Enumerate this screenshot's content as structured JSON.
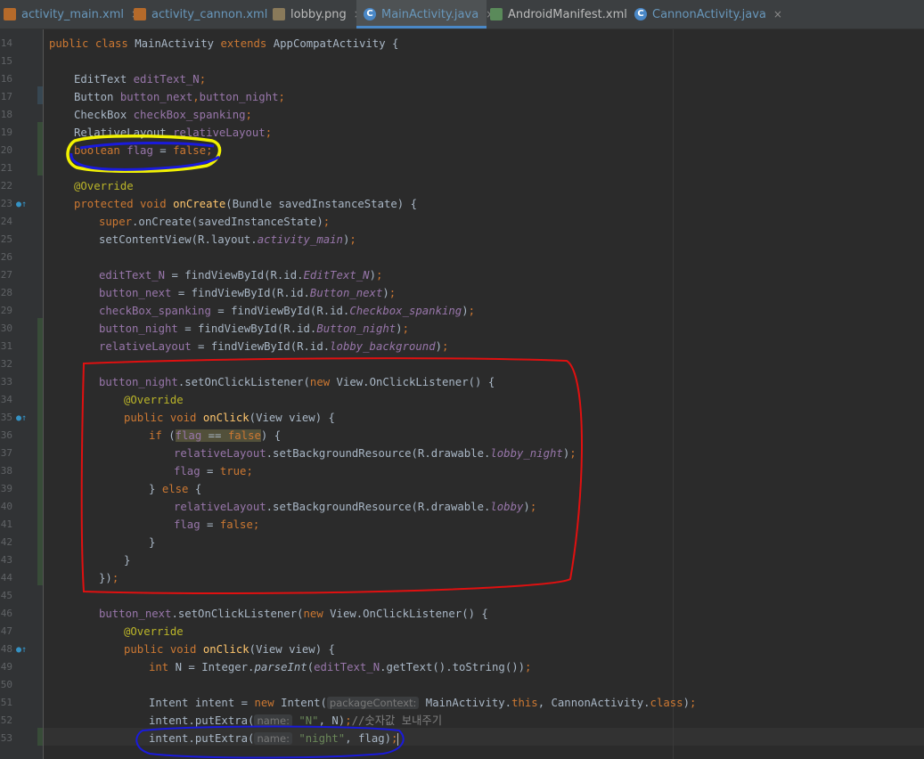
{
  "tabs": [
    {
      "name": "activity_main.xml",
      "icon": "xml-file-icon"
    },
    {
      "name": "activity_cannon.xml",
      "icon": "xml-file-icon"
    },
    {
      "name": "lobby.png",
      "icon": "image-file-icon"
    },
    {
      "name": "MainActivity.java",
      "icon": "java-class-icon",
      "active": true
    },
    {
      "name": "AndroidManifest.xml",
      "icon": "manifest-file-icon"
    },
    {
      "name": "CannonActivity.java",
      "icon": "java-class-icon"
    }
  ],
  "close_glyph": "×",
  "line_numbers": [
    "14",
    "15",
    "16",
    "17",
    "18",
    "19",
    "20",
    "21",
    "22",
    "23",
    "24",
    "25",
    "26",
    "27",
    "28",
    "29",
    "30",
    "31",
    "32",
    "33",
    "34",
    "35",
    "36",
    "37",
    "38",
    "39",
    "40",
    "41",
    "42",
    "43",
    "44",
    "45",
    "46",
    "47",
    "48",
    "49",
    "50",
    "51",
    "52",
    "53"
  ],
  "code": {
    "l14": {
      "a": "public class ",
      "b": "MainActivity ",
      "c": "extends ",
      "d": "AppCompatActivity {"
    },
    "l16": {
      "a": "EditText ",
      "b": "editText_N",
      ";": ";"
    },
    "l17": {
      "a": "Button ",
      "b": "button_next",
      "c": ",",
      "d": "button_night",
      ";": ";"
    },
    "l18": {
      "a": "CheckBox ",
      "b": "checkBox_spanking",
      ";": ";"
    },
    "l19": {
      "a": "RelativeLayout ",
      "b": "relativeLayout",
      ";": ";"
    },
    "l20": {
      "a": "boolean ",
      "b": "flag",
      " c": " = ",
      "d": "false",
      ";": ";"
    },
    "l22": {
      "a": "@Override"
    },
    "l23": {
      "a": "protected void ",
      "b": "onCreate",
      "c": "(Bundle savedInstanceState) {"
    },
    "l24": {
      "a": "super",
      ".": ".onCreate(savedInstanceState)",
      ";": ";"
    },
    "l25": {
      "a": "setContentView(R.layout.",
      "b": "activity_main",
      "c": ")",
      ";": ";"
    },
    "l27": {
      "a": "editText_N",
      " =": " = findViewById(R.id.",
      "b": "EditText_N",
      "c": ")",
      ";": ";"
    },
    "l28": {
      "a": "button_next",
      " =": " = findViewById(R.id.",
      "b": "Button_next",
      "c": ")",
      ";": ";"
    },
    "l29": {
      "a": "checkBox_spanking",
      " =": " = findViewById(R.id.",
      "b": "Checkbox_spanking",
      "c": ")",
      ";": ";"
    },
    "l30": {
      "a": "button_night",
      " =": " = findViewById(R.id.",
      "b": "Button_night",
      "c": ")",
      ";": ";"
    },
    "l31": {
      "a": "relativeLayout",
      " =": " = findViewById(R.id.",
      "b": "lobby_background",
      "c": ")",
      ";": ";"
    },
    "l33": {
      "a": "button_night",
      "b": ".setOnClickListener(",
      "c": "new ",
      "d": "View.OnClickListener() {"
    },
    "l34": {
      "a": "@Override"
    },
    "l35": {
      "a": "public void ",
      "b": "onClick",
      "c": "(View view) {"
    },
    "l36": {
      "a": "if ",
      "b": "(",
      "c": "flag",
      " ==": " == ",
      "d": "false",
      ")": ") {"
    },
    "l37": {
      "a": "relativeLayout",
      "b": ".setBackgroundResource(R.drawable.",
      "c": "lobby_night",
      "d": ")",
      ";": ";"
    },
    "l38": {
      "a": "flag",
      " =": " = ",
      "b": "true",
      ";": ";"
    },
    "l39": {
      "a": "} ",
      "b": "else ",
      "c": "{"
    },
    "l40": {
      "a": "relativeLayout",
      "b": ".setBackgroundResource(R.drawable.",
      "c": "lobby",
      "d": ")",
      ";": ";"
    },
    "l41": {
      "a": "flag",
      " =": " = ",
      "b": "false",
      ";": ";"
    },
    "l42": {
      "a": "}"
    },
    "l43": {
      "a": "}"
    },
    "l44": {
      "a": "})",
      ";": ";"
    },
    "l46": {
      "a": "button_next",
      "b": ".setOnClickListener(",
      "c": "new ",
      "d": "View.OnClickListener() {"
    },
    "l47": {
      "a": "@Override"
    },
    "l48": {
      "a": "public void ",
      "b": "onClick",
      "c": "(View view) {"
    },
    "l49": {
      "a": "int ",
      "b": "N = Integer.",
      "c": "parseInt",
      "d": "(",
      "e": "editText_N",
      "f": ".getText().toString())",
      ";": ";"
    },
    "l51": {
      "a": "Intent intent = ",
      "b": "new ",
      "c": "Intent(",
      "hint": "packageContext:",
      "d": " MainActivity.",
      "e": "this",
      ",": ", CannonActivity.",
      "f": "class",
      "g": ")",
      ";": ";"
    },
    "l52": {
      "a": "intent.putExtra(",
      "hint": "name:",
      "b": " \"N\"",
      ",": ", N)",
      ";": ";",
      "c": "//숫자값 보내주기"
    },
    "l53": {
      "a": "intent.putExtra(",
      "hint": "name:",
      "b": " \"night\"",
      ",": ", flag)",
      ";": ";"
    }
  }
}
